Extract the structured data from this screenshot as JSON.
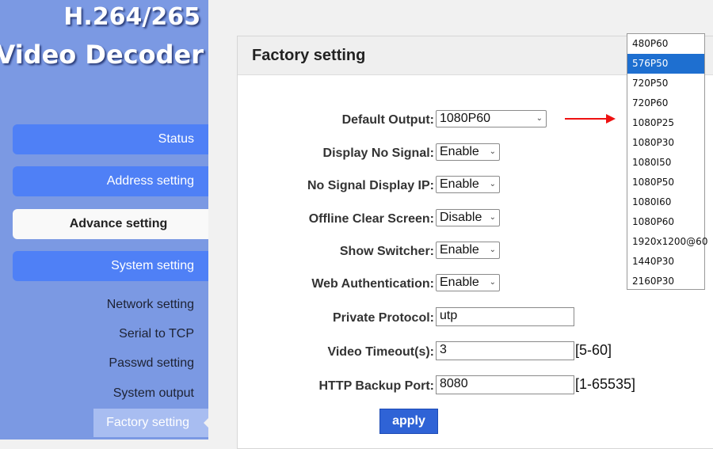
{
  "brand": {
    "line1": "H.264/265",
    "line2": "Video Decoder"
  },
  "nav": [
    {
      "label": "Status"
    },
    {
      "label": "Address setting"
    },
    {
      "label": "Advance setting"
    },
    {
      "label": "System setting"
    }
  ],
  "subnav": [
    {
      "label": "Network setting"
    },
    {
      "label": "Serial to TCP"
    },
    {
      "label": "Passwd setting"
    },
    {
      "label": "System output"
    },
    {
      "label": "Factory setting"
    }
  ],
  "panel": {
    "title": "Factory setting"
  },
  "form": {
    "default_output": {
      "label": "Default Output:",
      "value": "1080P60"
    },
    "display_no_signal": {
      "label": "Display No Signal:",
      "value": "Enable"
    },
    "no_signal_display_ip": {
      "label": "No Signal Display IP:",
      "value": "Enable"
    },
    "offline_clear_screen": {
      "label": "Offline Clear Screen:",
      "value": "Disable"
    },
    "show_switcher": {
      "label": "Show Switcher:",
      "value": "Enable"
    },
    "web_authentication": {
      "label": "Web Authentication:",
      "value": "Enable"
    },
    "private_protocol": {
      "label": "Private Protocol:",
      "value": "utp"
    },
    "video_timeout": {
      "label": "Video Timeout(s):",
      "value": "3",
      "hint": "[5-60]"
    },
    "http_backup_port": {
      "label": "HTTP Backup Port:",
      "value": "8080",
      "hint": "[1-65535]"
    },
    "apply_label": "apply"
  },
  "dropdown": {
    "selected": "576P50",
    "options": [
      "480P60",
      "576P50",
      "720P50",
      "720P60",
      "1080P25",
      "1080P30",
      "1080I50",
      "1080P50",
      "1080I60",
      "1080P60",
      "1920x1200@60",
      "1440P30",
      "2160P30"
    ]
  },
  "colors": {
    "sidebar": "#7b99e3",
    "nav_button": "#4f80f6",
    "apply": "#2f63d6",
    "selected_option": "#1e6fd0",
    "arrow": "#ee1111"
  }
}
